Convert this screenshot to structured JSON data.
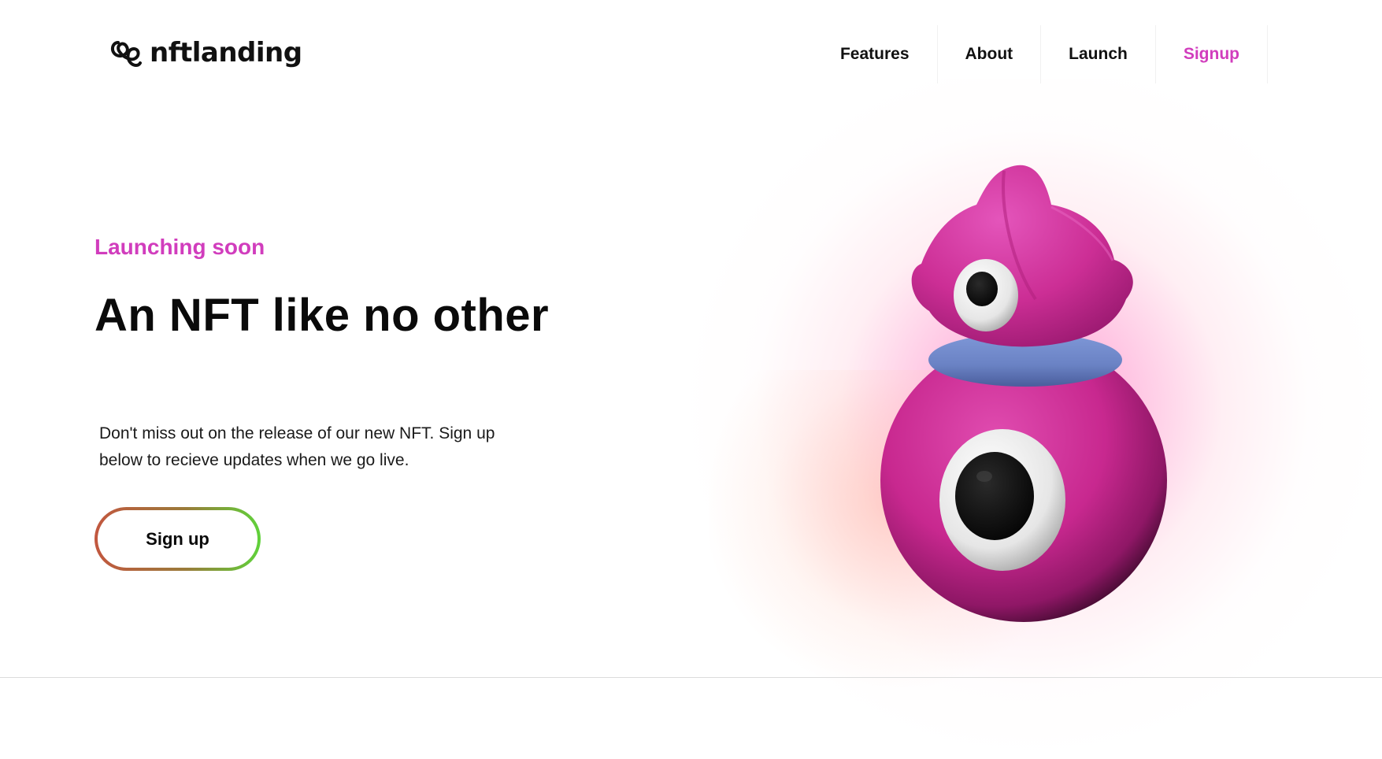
{
  "brand": {
    "name": "nftlanding",
    "icon": "spiral-logo-icon"
  },
  "nav": {
    "items": [
      {
        "label": "Features"
      },
      {
        "label": "About"
      },
      {
        "label": "Launch"
      },
      {
        "label": "Signup",
        "accent": true
      }
    ]
  },
  "hero": {
    "eyebrow": "Launching soon",
    "headline": "An NFT like no other",
    "description": "Don't miss out on the release of our new NFT. Sign up below to recieve updates when we go live.",
    "cta_label": "Sign up",
    "image": "pink-cyclops-creature-illustration"
  },
  "colors": {
    "accent": "#d13dbd",
    "text": "#0a0a0a",
    "cta_gradient_start": "#c2573f",
    "cta_gradient_end": "#5fd23a",
    "mascot_body": "#c8288f",
    "mascot_ring": "#6b86c9"
  }
}
